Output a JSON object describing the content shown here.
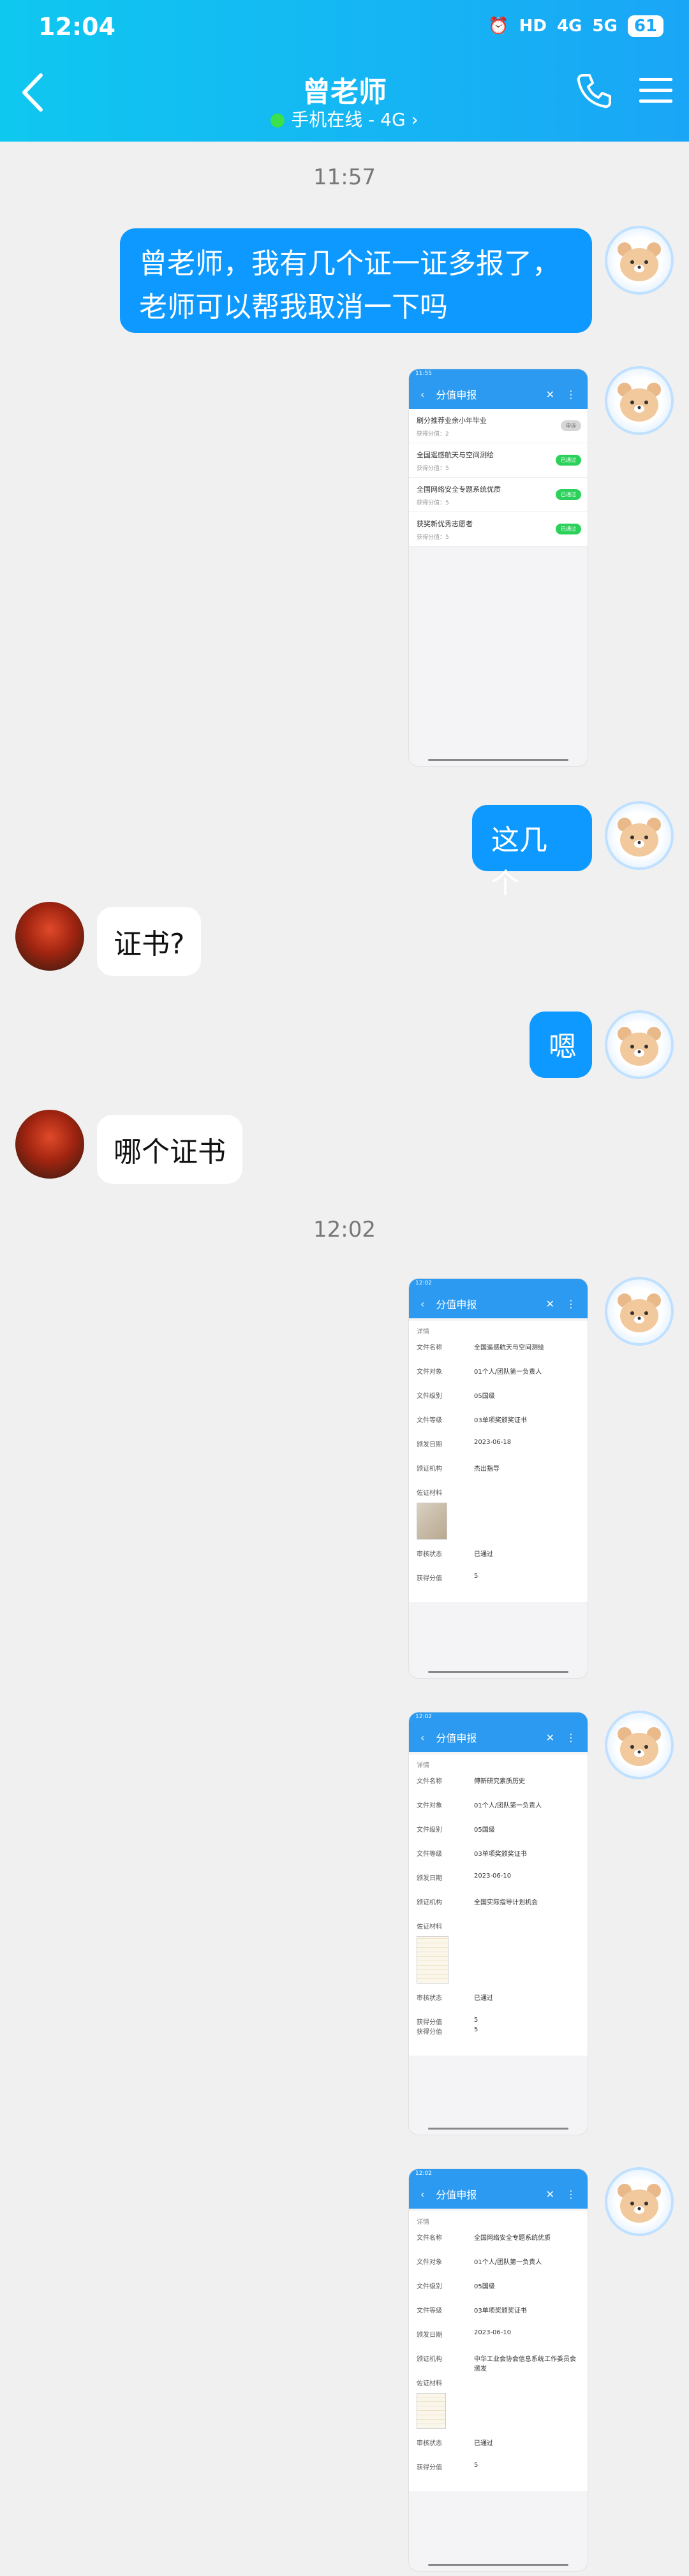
{
  "status": {
    "time": "12:04",
    "network": "4G",
    "network2": "5G",
    "battery": "61",
    "hd": "HD"
  },
  "header": {
    "title": "曾老师",
    "subtitle": "手机在线 - 4G ›"
  },
  "timestamps": [
    "11:57",
    "12:02"
  ],
  "messages": {
    "m1": "曾老师，我有几个证一证多报了，老师可以帮我取消一下吗",
    "m2": "这几个",
    "m3": "证书?",
    "m4": "嗯",
    "m5": "哪个证书"
  },
  "shot_common": {
    "status_time": "11:55",
    "status_time2": "12:02",
    "nav_title": "分值申报",
    "detail_header": "详情"
  },
  "shot_list": [
    {
      "title": "刷分推荐业余小年毕业",
      "sub": "获得分值：2",
      "status": "申诉"
    },
    {
      "title": "全国遥感航天与空间测绘",
      "sub": "获得分值：5",
      "status": "已通过"
    },
    {
      "title": "全国网络安全专题系统优质",
      "sub": "获得分值：5",
      "status": "已通过"
    },
    {
      "title": "获奖新优秀志愿者",
      "sub": "获得分值：5",
      "status": "已通过"
    }
  ],
  "detail_labels": {
    "name": "文件名称",
    "target": "文件对象",
    "level": "文件级别",
    "grade": "文件等级",
    "date": "颁发日期",
    "unit": "颁证机构",
    "material": "佐证材料",
    "review": "审核状态",
    "score": "获得分值"
  },
  "detail1": {
    "name": "全国遥感航天与空间测绘",
    "target": "01个人/团队第一负责人",
    "level": "05国级",
    "grade": "03单项奖颁奖证书",
    "date": "2023-06-18",
    "unit": "杰出指导",
    "review": "已通过",
    "score": "5"
  },
  "detail2": {
    "name": "傅新研究素质历史",
    "target": "01个人/团队第一负责人",
    "level": "05国级",
    "grade": "03单项奖颁奖证书",
    "date": "2023-06-10",
    "unit": "全国实际指导计划机会",
    "review": "已通过",
    "score": "5",
    "score2": "5"
  },
  "detail3": {
    "name": "全国网络安全专题系统优质",
    "target": "01个人/团队第一负责人",
    "level": "05国级",
    "grade": "03单项奖颁奖证书",
    "date": "2023-06-10",
    "unit": "中华工业会协会信息系统工作委员会颁发",
    "review": "已通过",
    "score": "5"
  }
}
